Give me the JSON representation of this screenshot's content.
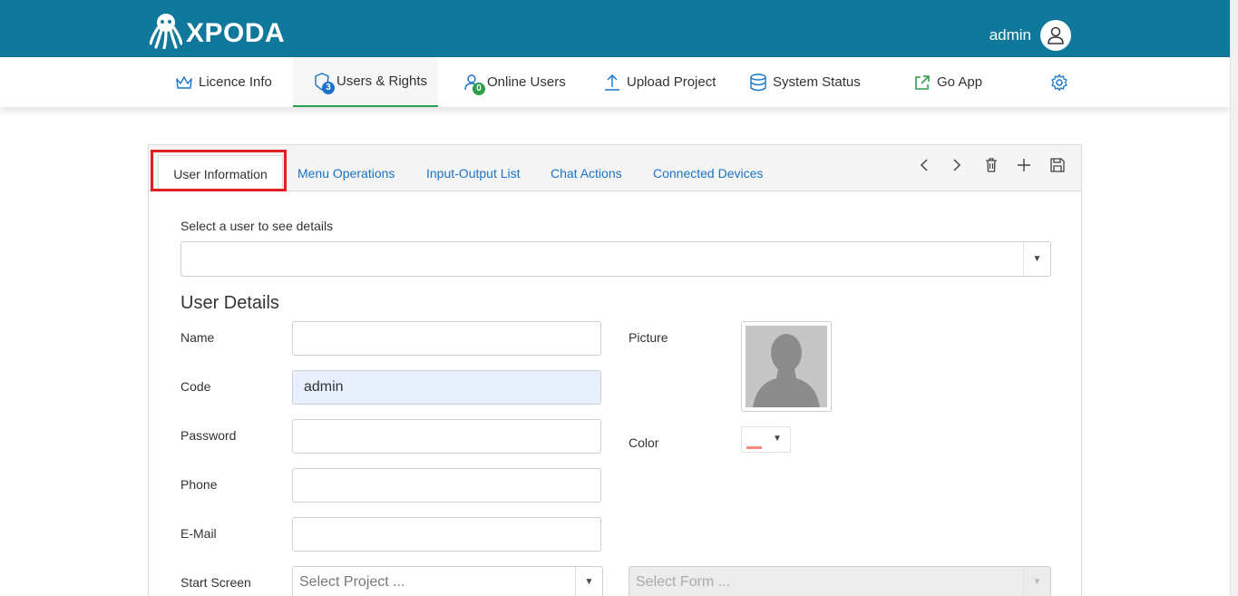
{
  "app": {
    "brand": "XPODA",
    "user": "admin"
  },
  "nav": [
    {
      "label": "Licence Info",
      "icon": "crown-icon"
    },
    {
      "label": "Users & Rights",
      "icon": "shield-users-icon",
      "badge": "3",
      "active": true
    },
    {
      "label": "Online Users",
      "icon": "online-user-icon",
      "badge": "0"
    },
    {
      "label": "Upload Project",
      "icon": "upload-icon"
    },
    {
      "label": "System Status",
      "icon": "database-icon"
    },
    {
      "label": "Go App",
      "icon": "external-link-icon"
    },
    {
      "label": "",
      "icon": "gear-icon"
    }
  ],
  "tabs": [
    "User Information",
    "Menu Operations",
    "Input-Output List",
    "Chat Actions",
    "Connected Devices"
  ],
  "toolbar": [
    "chevron-left-icon",
    "chevron-right-icon",
    "trash-icon",
    "plus-icon",
    "save-icon"
  ],
  "form": {
    "select_user_label": "Select a user to see details",
    "section_title": "User Details",
    "name_label": "Name",
    "name_value": "",
    "code_label": "Code",
    "code_value": "admin",
    "password_label": "Password",
    "phone_label": "Phone",
    "email_label": "E-Mail",
    "picture_label": "Picture",
    "color_label": "Color",
    "color_value": "#f08c7a",
    "start_screen_label": "Start Screen",
    "project_placeholder": "Select Project ...",
    "form_placeholder": "Select Form ..."
  },
  "colors": {
    "header": "#10789a",
    "accent": "#1a73c9",
    "active_underline": "#2e9f4c",
    "highlight": "#e02020"
  }
}
